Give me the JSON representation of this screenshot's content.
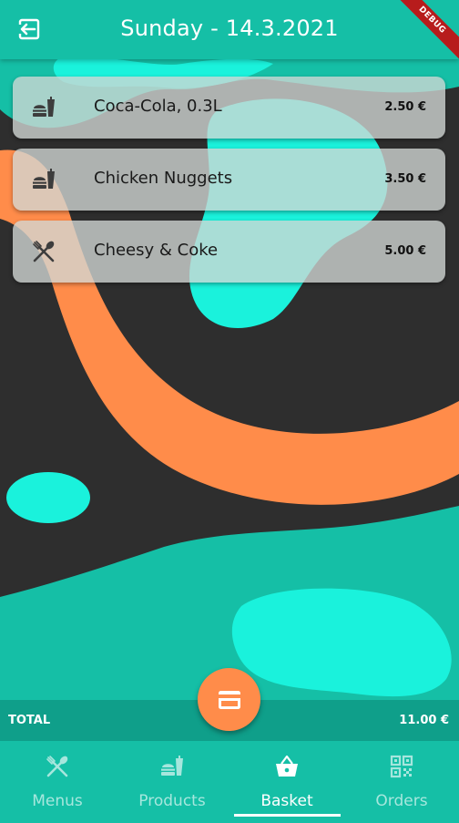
{
  "header": {
    "title": "Sunday - 14.3.2021",
    "back_icon": "logout-arrow-icon",
    "debug_label": "DEBUG"
  },
  "basket": {
    "items": [
      {
        "name": "Coca-Cola, 0.3L",
        "price": "2.50 €",
        "icon": "fastfood-icon"
      },
      {
        "name": "Chicken Nuggets",
        "price": "3.50 €",
        "icon": "fastfood-icon"
      },
      {
        "name": "Cheesy & Coke",
        "price": "5.00 €",
        "icon": "utensils-icon"
      }
    ]
  },
  "total": {
    "label": "TOTAL",
    "value": "11.00 €"
  },
  "fab": {
    "icon": "credit-card-icon"
  },
  "nav": {
    "items": [
      {
        "label": "Menus",
        "icon": "utensils-icon",
        "active": false
      },
      {
        "label": "Products",
        "icon": "fastfood-icon",
        "active": false
      },
      {
        "label": "Basket",
        "icon": "basket-icon",
        "active": true
      },
      {
        "label": "Orders",
        "icon": "qr-code-icon",
        "active": false
      }
    ]
  },
  "colors": {
    "primary": "#15bfa6",
    "accent": "#ff8c4a",
    "cyan": "#1af2dc",
    "dark": "#2e2e2e",
    "debug": "#b71c1c"
  }
}
